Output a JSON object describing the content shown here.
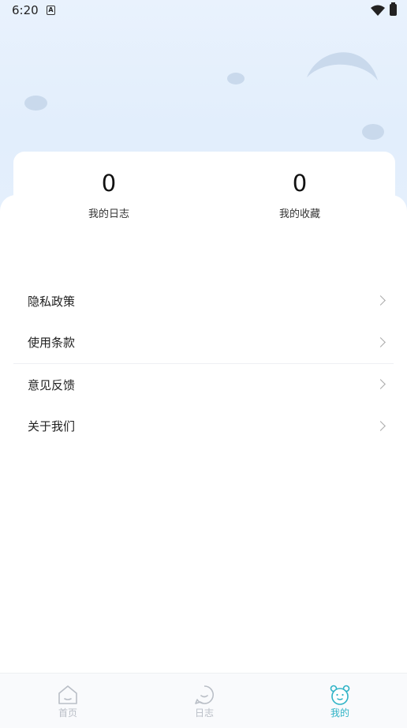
{
  "status_bar": {
    "time": "6:20",
    "a_icon": "A"
  },
  "stats": [
    {
      "value": "0",
      "label": "我的日志"
    },
    {
      "value": "0",
      "label": "我的收藏"
    }
  ],
  "menu": [
    {
      "label": "隐私政策"
    },
    {
      "label": "使用条款"
    },
    {
      "label": "意见反馈"
    },
    {
      "label": "关于我们"
    }
  ],
  "tabs": [
    {
      "label": "首页",
      "icon": "home-icon",
      "active": false
    },
    {
      "label": "日志",
      "icon": "smile-icon",
      "active": false
    },
    {
      "label": "我的",
      "icon": "bear-icon",
      "active": true
    }
  ],
  "colors": {
    "accent": "#2fb3c6",
    "inactive": "#b9bec6",
    "hero_bg": "#e4effc"
  }
}
